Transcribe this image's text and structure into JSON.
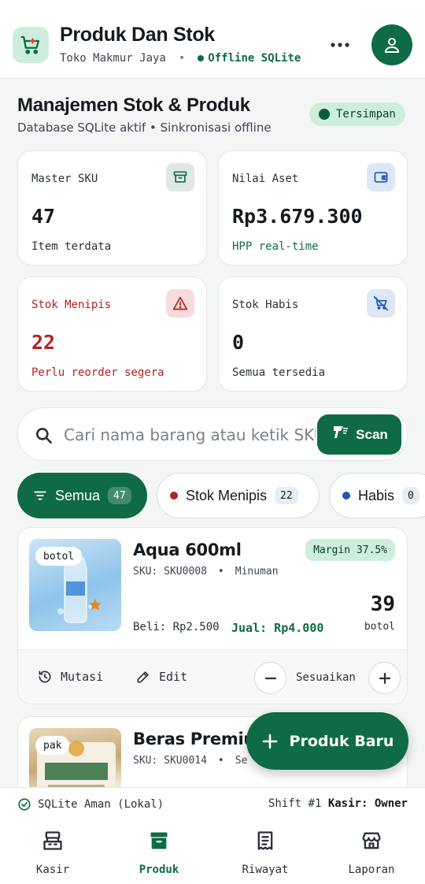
{
  "header": {
    "title": "Produk Dan Stok",
    "store": "Toko Makmur Jaya",
    "separator": "•",
    "mode": "Offline SQLite",
    "logo_icon": "cart-icon",
    "more_icon": "more-horizontal-icon",
    "avatar_icon": "user-icon"
  },
  "section": {
    "title": "Manajemen Stok & Produk",
    "subtitle": "Database SQLite aktif • Sinkronisasi offline",
    "saved_badge": "Tersimpan"
  },
  "stats": {
    "sku": {
      "label": "Master SKU",
      "value": "47",
      "note": "Item terdata",
      "icon": "archive-icon"
    },
    "asset": {
      "label": "Nilai Aset",
      "value": "Rp3.679.300",
      "note": "HPP real-time",
      "icon": "wallet-icon"
    },
    "low": {
      "label": "Stok Menipis",
      "value": "22",
      "note": "Perlu reorder segera",
      "icon": "warning-icon"
    },
    "empty": {
      "label": "Stok Habis",
      "value": "0",
      "note": "Semua tersedia",
      "icon": "cart-off-icon"
    }
  },
  "search": {
    "placeholder": "Cari nama barang atau ketik SKU...",
    "scan_label": "Scan"
  },
  "filters": [
    {
      "label": "Semua",
      "count": "47"
    },
    {
      "label": "Stok Menipis",
      "count": "22"
    },
    {
      "label": "Habis",
      "count": "0"
    }
  ],
  "products": [
    {
      "name": "Aqua 600ml",
      "unit_tag": "botol",
      "sku": "SKU: SKU0008",
      "category": "Minuman",
      "margin": "Margin 37.5%",
      "qty": "39",
      "unit": "botol",
      "buy": "Beli: Rp2.500",
      "sell": "Jual: Rp4.000"
    },
    {
      "name": "Beras Premium",
      "unit_tag": "pak",
      "sku": "SKU: SKU0014",
      "category": "Se"
    }
  ],
  "actions": {
    "mutasi": "Mutasi",
    "edit": "Edit",
    "adjust": "Sesuaikan"
  },
  "fab": {
    "label": "Produk Baru"
  },
  "footer": {
    "status": "SQLite Aman (Lokal)",
    "shift": "Shift #1",
    "kasir_label": "Kasir:",
    "kasir_value": "Owner"
  },
  "nav": [
    {
      "label": "Kasir",
      "icon": "cash-register-icon"
    },
    {
      "label": "Produk",
      "icon": "archive-icon",
      "active": true
    },
    {
      "label": "Riwayat",
      "icon": "receipt-icon"
    },
    {
      "label": "Laporan",
      "icon": "store-icon"
    }
  ],
  "colors": {
    "primary": "#0f6b46",
    "primary_soft": "#cdeedd",
    "danger": "#b42323",
    "info": "#1f57b5"
  }
}
